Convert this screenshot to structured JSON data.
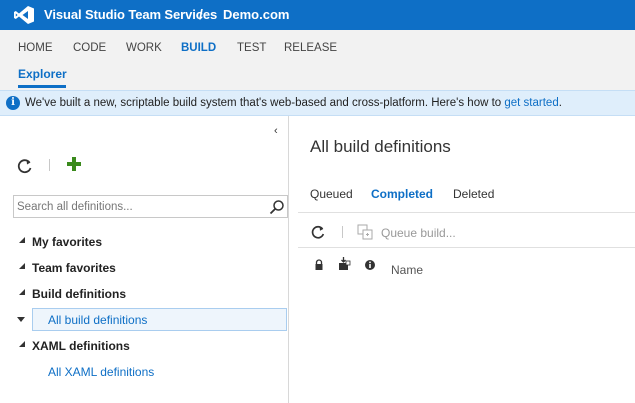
{
  "topbar": {
    "app_title": "Visual Studio Team Services",
    "separator": "/",
    "project": "Demo.com",
    "icon": "visual-studio-logo-icon",
    "color": "#0e6fc6"
  },
  "hubnav": {
    "items": [
      "HOME",
      "CODE",
      "WORK",
      "BUILD",
      "TEST",
      "RELEASE"
    ],
    "active": "BUILD",
    "subtab": "Explorer"
  },
  "banner": {
    "icon": "info-icon",
    "text": "We've built a new, scriptable build system that's web-based and cross-platform. Here's how to ",
    "link": "get started",
    "suffix": "."
  },
  "left": {
    "collapse_glyph": "‹",
    "search_placeholder": "Search all definitions...",
    "tree": [
      {
        "label": "My favorites",
        "bold": true
      },
      {
        "label": "Team favorites",
        "bold": true
      },
      {
        "label": "Build definitions",
        "bold": true
      },
      {
        "label": "All build definitions",
        "bold": false,
        "selected": true
      },
      {
        "label": "XAML definitions",
        "bold": true
      },
      {
        "label": "All XAML definitions",
        "bold": false
      }
    ]
  },
  "right": {
    "title": "All build definitions",
    "tabs": [
      "Queued",
      "Completed",
      "Deleted"
    ],
    "active_tab": "Completed",
    "queue_label": "Queue build...",
    "column_name": "Name"
  }
}
